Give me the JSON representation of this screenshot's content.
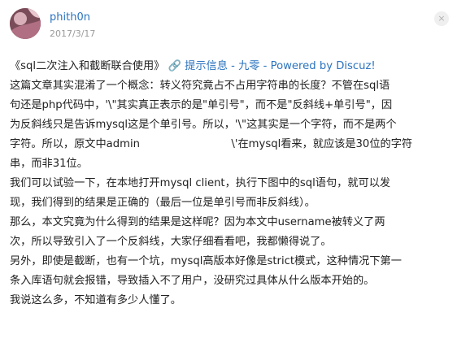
{
  "header": {
    "author": "phith0n",
    "date": "2017/3/17",
    "more_icon": "close-icon"
  },
  "post": {
    "title": "《sql二次注入和截断联合使用》",
    "link_icon": "link-icon",
    "link_text": "提示信息 - 九零 - Powered by Discuz!",
    "lines": [
      "这篇文章其实混淆了一个概念：转义符究竟占不占用字符串的长度？不管在sql语",
      "句还是php代码中，'\\\"其实真正表示的是\"单引号\"，而不是\"反斜线+单引号\"，因",
      "为反斜线只是告诉mysql这是个单引号。所以，'\\\"这其实是一个字符，而不是两个",
      "字符。所以，原文中admin",
      "\\'在mysql看来，就应该是30位的字符",
      "串，而非31位。",
      "我们可以试验一下，在本地打开mysql client，执行下图中的sql语句，就可以发",
      "现，我们得到的结果是正确的（最后一位是单引号而非反斜线）。",
      "那么，本文究竟为什么得到的结果是这样呢？因为本文中username被转义了两",
      "次，所以导致引入了一个反斜线，大家仔细看看吧，我都懒得说了。",
      "另外，即使是截断，也有一个坑，mysql高版本好像是strict模式，这种情况下第一",
      "条入库语句就会报错，导致插入不了用户，没研究过具体从什么版本开始的。",
      "我说这么多，不知道有多少人懂了。"
    ]
  },
  "colors": {
    "link": "#2b73bf",
    "text": "#222222",
    "muted": "#9a9a9a"
  }
}
